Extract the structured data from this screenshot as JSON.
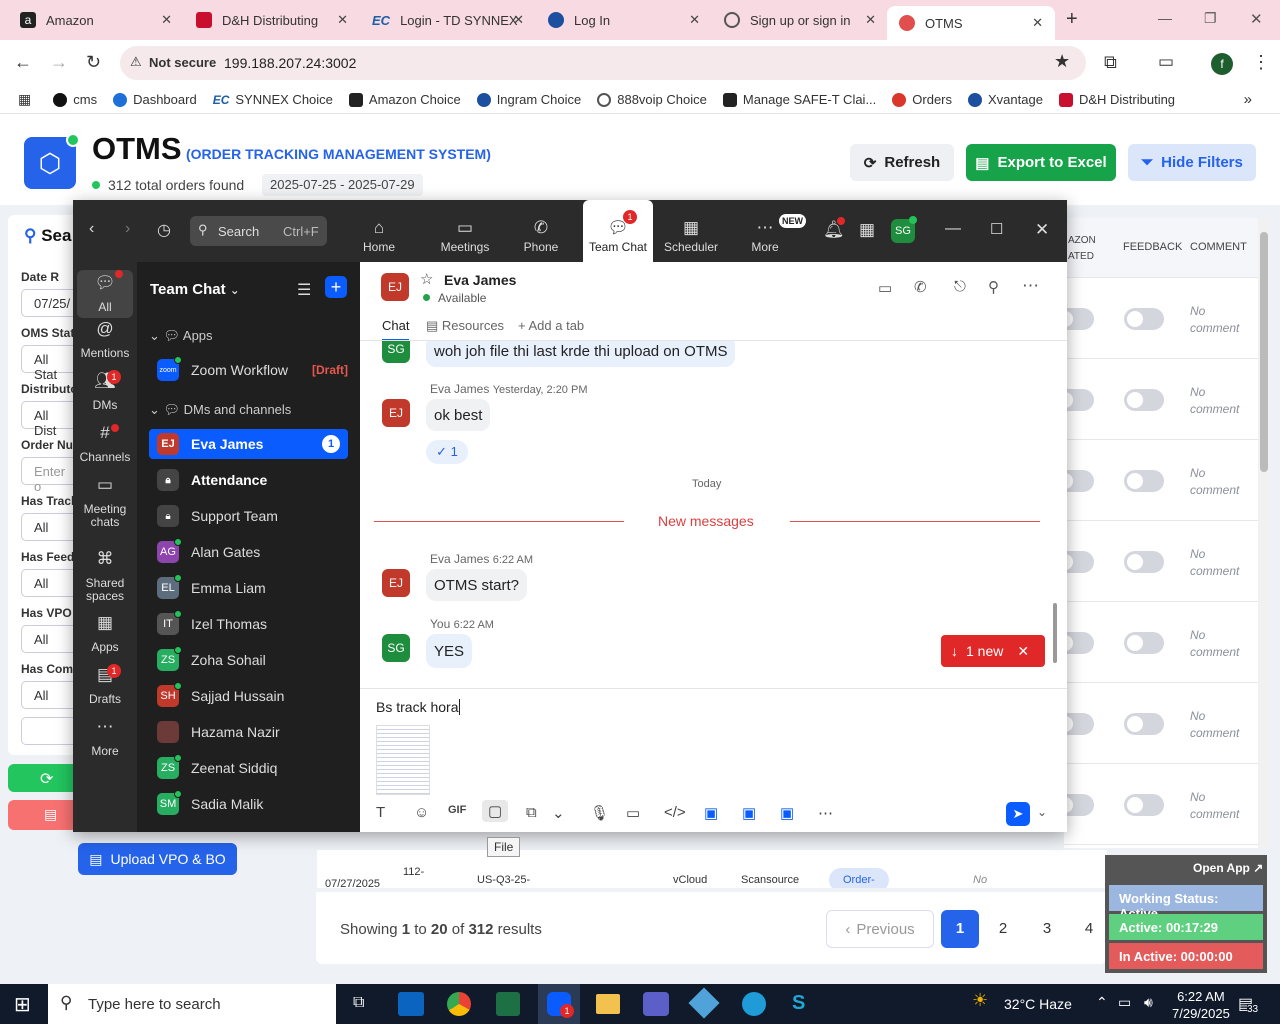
{
  "browser": {
    "tabs": [
      {
        "label": "Amazon",
        "color": "#222"
      },
      {
        "label": "D&H Distributing",
        "color": "#c8102e"
      },
      {
        "label": "Login - TD SYNNEX",
        "color": "#1b5fa8"
      },
      {
        "label": "Log In",
        "color": "#1d4fa0"
      },
      {
        "label": "Sign up or sign in",
        "color": "#555"
      },
      {
        "label": "OTMS",
        "color": "#e04e4e"
      }
    ],
    "security_label": "Not secure",
    "url": "199.188.207.24:3002",
    "bookmarks": [
      "cms",
      "Dashboard",
      "SYNNEX Choice",
      "Amazon Choice",
      "Ingram Choice",
      "888voip Choice",
      "Manage SAFE-T Clai...",
      "Orders",
      "Xvantage",
      "D&H Distributing"
    ],
    "profile_initial": "f"
  },
  "app": {
    "title": "OTMS",
    "subtitle": "(ORDER TRACKING MANAGEMENT SYSTEM)",
    "orders_found": "312 total orders found",
    "date_range": "2025-07-25 - 2025-07-29",
    "refresh_label": "Refresh",
    "export_label": "Export to Excel",
    "hide_filters_label": "Hide Filters",
    "filters": {
      "search_label": "Sea",
      "date_label": "Date R",
      "date_value": "07/25/",
      "oms_label": "OMS Stat",
      "oms_value": "All Stat",
      "dist_label": "Distributo",
      "dist_value": "All Dist",
      "order_label": "Order Nu",
      "order_placeholder": "Enter o",
      "track_label": "Has Track",
      "track_value": "All",
      "feed_label": "Has Feedb",
      "feed_value": "All",
      "vpo_label": "Has VPO",
      "vpo_value": "All",
      "comm_label": "Has Comm",
      "comm_value": "All"
    },
    "upload_label": "Upload VPO & BO",
    "columns": {
      "amazon": "AZON",
      "amazon2": "ATED",
      "feedback": "FEEDBACK",
      "comment": "COMMENT"
    },
    "no_comment_line1": "No",
    "no_comment_line2": "comment",
    "partial_row": {
      "date": "07/27/2025",
      "order": "112-",
      "po": "US-Q3-25-",
      "cloud": "vCloud",
      "dist": "Scansource",
      "status": "Order-",
      "no": "No"
    },
    "pagination": {
      "showing_prefix": "Showing",
      "from": "1",
      "to_word": "to",
      "to": "20",
      "of_word": "of",
      "total": "312",
      "results_word": "results",
      "previous": "Previous",
      "pages": [
        "1",
        "2",
        "3",
        "4"
      ]
    },
    "working": {
      "open_app": "Open App",
      "status": "Working Status: Active",
      "active": "Active: 00:17:29",
      "inactive": "In Active: 00:00:00"
    }
  },
  "zoom": {
    "search_label": "Search",
    "search_shortcut": "Ctrl+F",
    "top_nav": [
      {
        "label": "Home",
        "icon": "home-icon"
      },
      {
        "label": "Meetings",
        "icon": "video-icon"
      },
      {
        "label": "Phone",
        "icon": "phone-icon"
      },
      {
        "label": "Team Chat",
        "icon": "chat-icon",
        "badge": "1"
      },
      {
        "label": "Scheduler",
        "icon": "calendar-icon"
      },
      {
        "label": "More",
        "icon": "more-icon",
        "badge": "NEW"
      }
    ],
    "avatar": "SG",
    "rail": [
      {
        "label": "All"
      },
      {
        "label": "Mentions"
      },
      {
        "label": "DMs",
        "badge": "1"
      },
      {
        "label": "Channels"
      },
      {
        "label": "Meeting chats"
      },
      {
        "label": "Shared spaces"
      },
      {
        "label": "Apps"
      },
      {
        "label": "Drafts",
        "badge": "1"
      },
      {
        "label": "More"
      }
    ],
    "panel_title": "Team Chat",
    "apps_header": "Apps",
    "workflow": "Zoom Workflow",
    "draft": "[Draft]",
    "dms_header": "DMs and channels",
    "contacts": [
      {
        "name": "Eva James",
        "initials": "EJ",
        "color": "#c0392b",
        "unread": "1"
      },
      {
        "name": "Attendance",
        "initials": "",
        "color": "#444"
      },
      {
        "name": "Support Team",
        "initials": "",
        "color": "#444"
      },
      {
        "name": "Alan Gates",
        "initials": "AG",
        "color": "#8e44ad"
      },
      {
        "name": "Emma Liam",
        "initials": "EL",
        "color": "#5d6d7e"
      },
      {
        "name": "Izel Thomas",
        "initials": "IT",
        "color": "#555"
      },
      {
        "name": "Zoha Sohail",
        "initials": "ZS",
        "color": "#27ae60"
      },
      {
        "name": "Sajjad Hussain",
        "initials": "SH",
        "color": "#c0392b"
      },
      {
        "name": "Hazama Nazir",
        "initials": "",
        "color": "#6d3a3a"
      },
      {
        "name": "Zeenat Siddiq",
        "initials": "ZS",
        "color": "#27ae60"
      },
      {
        "name": "Sadia Malik",
        "initials": "SM",
        "color": "#27ae60"
      }
    ],
    "chat": {
      "contact_name": "Eva James",
      "contact_initials": "EJ",
      "presence": "Available",
      "tabs": [
        "Chat",
        "Resources",
        "Add a tab"
      ],
      "m1": "woh joh file thi last krde thi upload on OTMS",
      "m2_sender": "Eva James",
      "m2_time": "Yesterday, 2:20 PM",
      "m2": "ok best",
      "reaction": "✓ 1",
      "today": "Today",
      "new_messages": "New messages",
      "m3_sender": "Eva James",
      "m3_time": "6:22 AM",
      "m3": "OTMS start?",
      "m4_sender": "You",
      "m4_time": "6:22 AM",
      "m4": "YES",
      "new_pill": "1 new",
      "compose": "Bs track hora",
      "tooltip": "File"
    }
  },
  "taskbar": {
    "search_placeholder": "Type here to search",
    "weather": "32°C  Haze",
    "time": "6:22 AM",
    "date": "7/29/2025",
    "notif": "33"
  }
}
